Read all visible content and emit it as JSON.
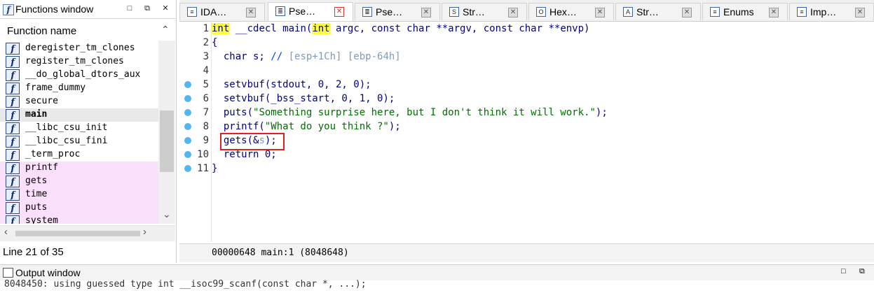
{
  "functions_window": {
    "title": "Functions window",
    "column_header": "Function name",
    "items": [
      {
        "name": "deregister_tm_clones",
        "kind": "normal"
      },
      {
        "name": "register_tm_clones",
        "kind": "normal"
      },
      {
        "name": "__do_global_dtors_aux",
        "kind": "normal"
      },
      {
        "name": "frame_dummy",
        "kind": "normal"
      },
      {
        "name": "secure",
        "kind": "normal"
      },
      {
        "name": "main",
        "kind": "selected"
      },
      {
        "name": "__libc_csu_init",
        "kind": "normal"
      },
      {
        "name": "__libc_csu_fini",
        "kind": "normal"
      },
      {
        "name": "_term_proc",
        "kind": "normal"
      },
      {
        "name": "printf",
        "kind": "import"
      },
      {
        "name": "gets",
        "kind": "import"
      },
      {
        "name": "time",
        "kind": "import"
      },
      {
        "name": "puts",
        "kind": "import"
      },
      {
        "name": "system",
        "kind": "import"
      }
    ],
    "status": "Line 21 of 35"
  },
  "tabs": [
    {
      "label": "IDA…",
      "icon": "ida-view-icon",
      "glyph": "≡",
      "active": false
    },
    {
      "label": "Pse…",
      "icon": "pseudocode-icon",
      "glyph": "≣",
      "active": true
    },
    {
      "label": "Pse…",
      "icon": "pseudocode-icon",
      "glyph": "≣",
      "active": false
    },
    {
      "label": "Str…",
      "icon": "structures-icon",
      "glyph": "S",
      "active": false
    },
    {
      "label": "Hex…",
      "icon": "hex-view-icon",
      "glyph": "O",
      "active": false
    },
    {
      "label": "Str…",
      "icon": "strings-icon",
      "glyph": "A",
      "active": false
    },
    {
      "label": "Enums",
      "icon": "enums-icon",
      "glyph": "≡",
      "active": false
    },
    {
      "label": "Imp…",
      "icon": "imports-icon",
      "glyph": "≡",
      "active": false
    }
  ],
  "code": {
    "lines": [
      {
        "n": "1",
        "dot": false,
        "parts": [
          [
            "kw",
            "int"
          ],
          [
            "",
            " __cdecl main("
          ],
          [
            "kw",
            "int"
          ],
          [
            "",
            " argc, const char **argv, const char **envp)"
          ]
        ]
      },
      {
        "n": "2",
        "dot": false,
        "parts": [
          [
            "",
            "{"
          ]
        ]
      },
      {
        "n": "3",
        "dot": false,
        "parts": [
          [
            "",
            "  char s; "
          ],
          [
            "cmtc",
            "//"
          ],
          [
            "cmt",
            " [esp+1Ch] [ebp-64h]"
          ]
        ]
      },
      {
        "n": "4",
        "dot": false,
        "parts": [
          [
            "",
            ""
          ]
        ]
      },
      {
        "n": "5",
        "dot": true,
        "parts": [
          [
            "",
            "  setvbuf(stdout, 0, 2, 0);"
          ]
        ]
      },
      {
        "n": "6",
        "dot": true,
        "parts": [
          [
            "",
            "  setvbuf(_bss_start, 0, 1, 0);"
          ]
        ]
      },
      {
        "n": "7",
        "dot": true,
        "parts": [
          [
            "",
            "  puts("
          ],
          [
            "str",
            "\"Something surprise here, but I don't think it will work.\""
          ],
          [
            "",
            ");"
          ]
        ]
      },
      {
        "n": "8",
        "dot": true,
        "parts": [
          [
            "",
            "  printf("
          ],
          [
            "str",
            "\"What do you think ?\""
          ],
          [
            "",
            ");"
          ]
        ]
      },
      {
        "n": "9",
        "dot": true,
        "parts": [
          [
            "",
            "  gets(&"
          ],
          [
            "cmt",
            "s"
          ],
          [
            "",
            ");"
          ]
        ]
      },
      {
        "n": "10",
        "dot": true,
        "parts": [
          [
            "",
            "  return 0;"
          ]
        ]
      },
      {
        "n": "11",
        "dot": true,
        "parts": [
          [
            "",
            "}"
          ]
        ]
      }
    ],
    "status": "00000648 main:1 (8048648)"
  },
  "output_window": {
    "title": "Output window",
    "visible_line": "8048450: using guessed type int __isoc99_scanf(const char *, ...);"
  },
  "colors": {
    "keyword_highlight": "#ffff3a",
    "import_row": "#fbe0fb",
    "highlight_box": "#e0211d",
    "breakpoint_dot": "#52b6f0"
  }
}
